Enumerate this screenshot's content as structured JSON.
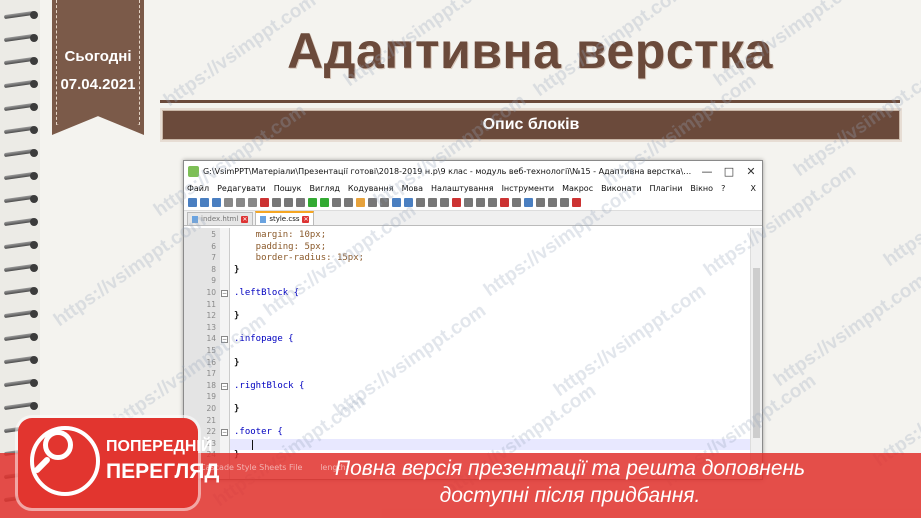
{
  "slide": {
    "today_label": "Сьогодні",
    "date": "07.04.2021",
    "title": "Адаптивна верстка",
    "subtitle": "Опис блоків",
    "colors": {
      "brown": "#6b4a3b",
      "banner_red": "#e2352f"
    }
  },
  "editor": {
    "window_title": "G:\\VsimPPT\\Матеріали\\Презентації готові\\2018-2019 н.р\\9 клас - модуль веб-технології\\№15 - Адаптивна верстка\\Доповнення\\Для...",
    "window_buttons": [
      "—",
      "□",
      "✕"
    ],
    "menu": [
      "Файл",
      "Редагувати",
      "Пошук",
      "Вигляд",
      "Кодування",
      "Мова",
      "Налаштування",
      "Інструменти",
      "Макрос",
      "Виконати",
      "Плагіни",
      "Вікно",
      "?"
    ],
    "menu_close": "X",
    "tabs": [
      {
        "label": "index.html",
        "active": false
      },
      {
        "label": "style.css",
        "active": true
      }
    ],
    "lines": [
      {
        "n": "5",
        "text": "    margin: 10px;"
      },
      {
        "n": "6",
        "text": "    padding: 5px;"
      },
      {
        "n": "7",
        "text": "    border-radius: 15px;"
      },
      {
        "n": "8",
        "text": "}"
      },
      {
        "n": "9",
        "text": ""
      },
      {
        "n": "10",
        "text": ".leftBlock {"
      },
      {
        "n": "11",
        "text": ""
      },
      {
        "n": "12",
        "text": "}"
      },
      {
        "n": "13",
        "text": ""
      },
      {
        "n": "14",
        "text": ".infopage {"
      },
      {
        "n": "15",
        "text": ""
      },
      {
        "n": "16",
        "text": "}"
      },
      {
        "n": "17",
        "text": ""
      },
      {
        "n": "18",
        "text": ".rightBlock {"
      },
      {
        "n": "19",
        "text": ""
      },
      {
        "n": "20",
        "text": "}"
      },
      {
        "n": "21",
        "text": ""
      },
      {
        "n": "22",
        "text": ".footer {"
      },
      {
        "n": "23",
        "text": ""
      },
      {
        "n": "24",
        "text": "}"
      }
    ],
    "status_left": "Cascade Style Sheets File",
    "status_length": "length:"
  },
  "watermark": "https://vsimppt.com",
  "preview": {
    "badge_line1": "ПОПЕРЕДНІЙ",
    "badge_line2": "ПЕРЕГЛЯД",
    "text_line1": "Повна версія презентації та решта доповнень",
    "text_line2": "доступні після придбання."
  }
}
